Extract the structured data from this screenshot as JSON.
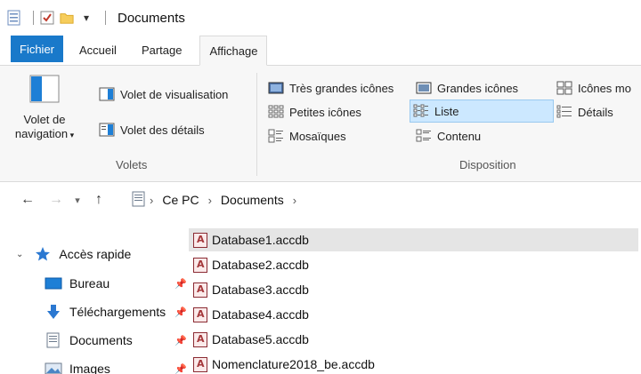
{
  "window": {
    "title": "Documents"
  },
  "tabs": [
    {
      "label": "Fichier"
    },
    {
      "label": "Accueil"
    },
    {
      "label": "Partage"
    },
    {
      "label": "Affichage"
    }
  ],
  "ribbon": {
    "volets": {
      "nav_pane_label_1": "Volet de",
      "nav_pane_label_2": "navigation",
      "preview_label": "Volet de visualisation",
      "details_label": "Volet des détails",
      "group_label": "Volets"
    },
    "disposition": {
      "items": [
        "Très grandes icônes",
        "Grandes icônes",
        "Icônes mo",
        "Petites icônes",
        "Liste",
        "Détails",
        "Mosaïques",
        "Contenu"
      ],
      "selected": "Liste",
      "group_label": "Disposition"
    }
  },
  "address": {
    "crumbs": [
      "Ce PC",
      "Documents"
    ]
  },
  "nav_pane": {
    "quick_access": "Accès rapide",
    "items": [
      "Bureau",
      "Téléchargements",
      "Documents",
      "Images"
    ]
  },
  "files": [
    "Database1.accdb",
    "Database2.accdb",
    "Database3.accdb",
    "Database4.accdb",
    "Database5.accdb",
    "Nomenclature2018_be.accdb"
  ],
  "colors": {
    "file_tab": "#1979ca",
    "selection_bg": "#cce8ff",
    "selection_border": "#99c9ef",
    "hover_row": "#e5e5e5"
  }
}
